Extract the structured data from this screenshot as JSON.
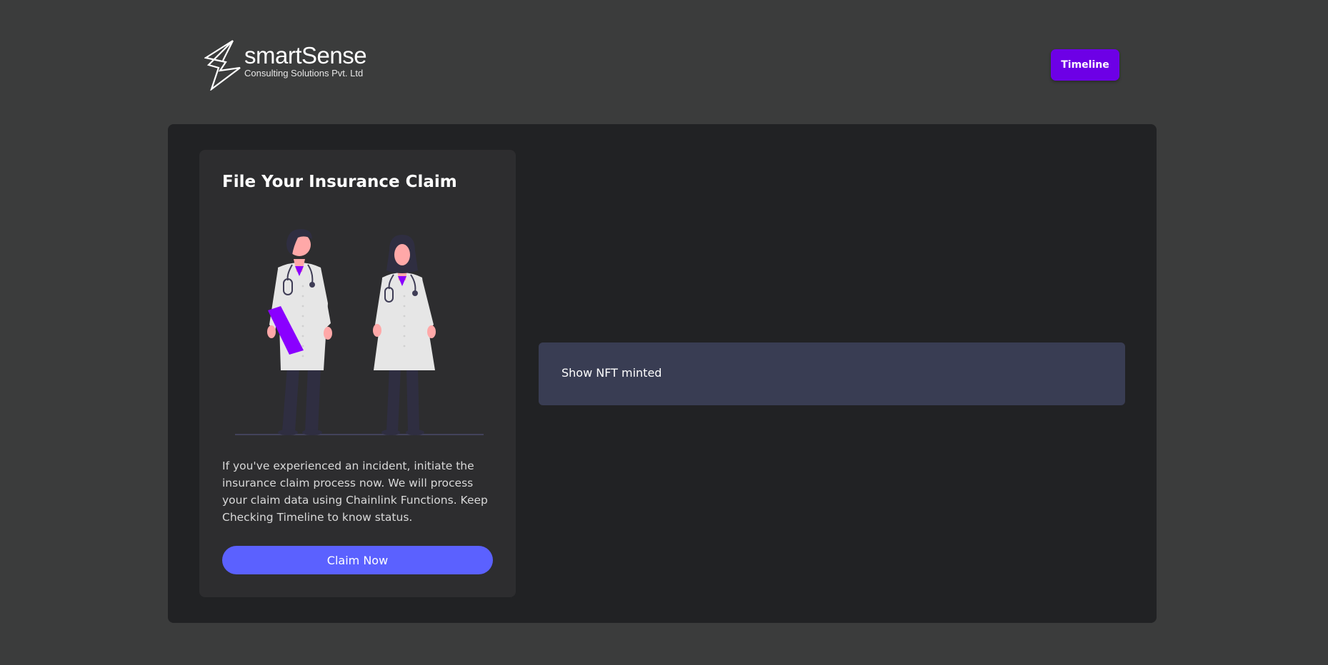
{
  "header": {
    "logo": {
      "name": "smartSense",
      "subtitle": "Consulting Solutions Pvt. Ltd"
    },
    "timeline_label": "Timeline"
  },
  "claim_card": {
    "title": "File Your Insurance Claim",
    "description": "If you've experienced an incident, initiate the insurance claim process now. We will process your claim data using Chainlink Functions. Keep Checking Timeline to know status.",
    "button_label": "Claim Now",
    "illustration": "two-doctors-illustration"
  },
  "nft_panel": {
    "label": "Show NFT minted"
  },
  "colors": {
    "page_background": "#3b3c3c",
    "panel_background": "#212224",
    "card_background": "#2d2d2f",
    "timeline_button": "#6d00e6",
    "claim_button": "#5b61ff",
    "nft_box": "#393d53"
  }
}
